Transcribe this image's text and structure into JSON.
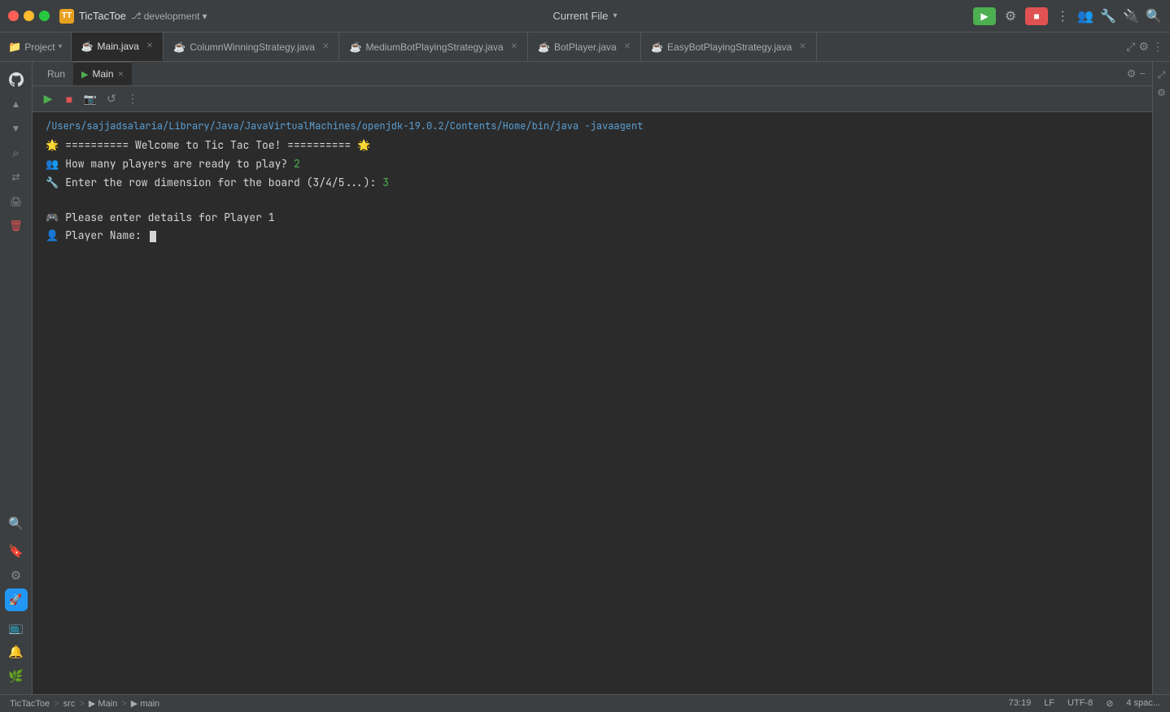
{
  "titleBar": {
    "trafficLights": [
      "red",
      "yellow",
      "green"
    ],
    "appIcon": "TT",
    "appName": "TicTacToe",
    "branch": "development",
    "branchChevron": "▾",
    "currentFile": "Current File",
    "currentFileChevron": "▾"
  },
  "tabs": [
    {
      "label": "Main.java",
      "icon": "☕",
      "active": true,
      "closeable": true
    },
    {
      "label": "ColumnWinningStrategy.java",
      "icon": "☕",
      "active": false,
      "closeable": true
    },
    {
      "label": "MediumBotPlayingStrategy.java",
      "icon": "☕",
      "active": false,
      "closeable": true
    },
    {
      "label": "BotPlayer.java",
      "icon": "☕",
      "active": false,
      "closeable": true
    },
    {
      "label": "EasyBotPlayingStrategy.java",
      "icon": "☕",
      "active": false,
      "closeable": true
    }
  ],
  "runPanel": {
    "tabs": [
      {
        "label": "Run",
        "active": false
      },
      {
        "label": "Main",
        "icon": "▶",
        "active": true,
        "closeable": true
      }
    ],
    "toolbar": [
      {
        "icon": "▶",
        "name": "resume",
        "color": "green"
      },
      {
        "icon": "■",
        "name": "stop",
        "color": "red"
      },
      {
        "icon": "📷",
        "name": "screenshot"
      },
      {
        "icon": "↺",
        "name": "restart"
      },
      {
        "icon": "⋮",
        "name": "more"
      }
    ]
  },
  "console": {
    "pathLine": "/Users/sajjadsalaria/Library/Java/JavaVirtualMachines/openjdk-19.0.2/Contents/Home/bin/java -javaagent",
    "lines": [
      {
        "emoji": "🌟",
        "text": "========== Welcome to Tic Tac Toe! ==========",
        "emoji2": "🌟"
      },
      {
        "emoji": "👥",
        "text": "How many players are ready to play? ",
        "highlight": "2"
      },
      {
        "emoji": "🔧",
        "text": "Enter the row dimension for the board (3/4/5...): ",
        "highlight": "3"
      },
      {
        "empty": true
      },
      {
        "emoji": "🎮",
        "text": "Please enter details for Player 1"
      },
      {
        "emoji": "👤",
        "text": "Player Name: ",
        "cursor": true
      }
    ]
  },
  "statusBar": {
    "breadcrumb": "TicTacToe > src > Main > main",
    "position": "73:19",
    "lineEnding": "LF",
    "encoding": "UTF-8",
    "indentation": "4 spac..."
  },
  "sidebarIcons": {
    "top": [
      "📁",
      "⌕",
      "☁",
      "🔀",
      "🖨",
      "🗑"
    ],
    "bottom": [
      "🔍",
      "🔖",
      "⚙",
      "🚀",
      "📺",
      "🔔",
      "🌿"
    ]
  }
}
